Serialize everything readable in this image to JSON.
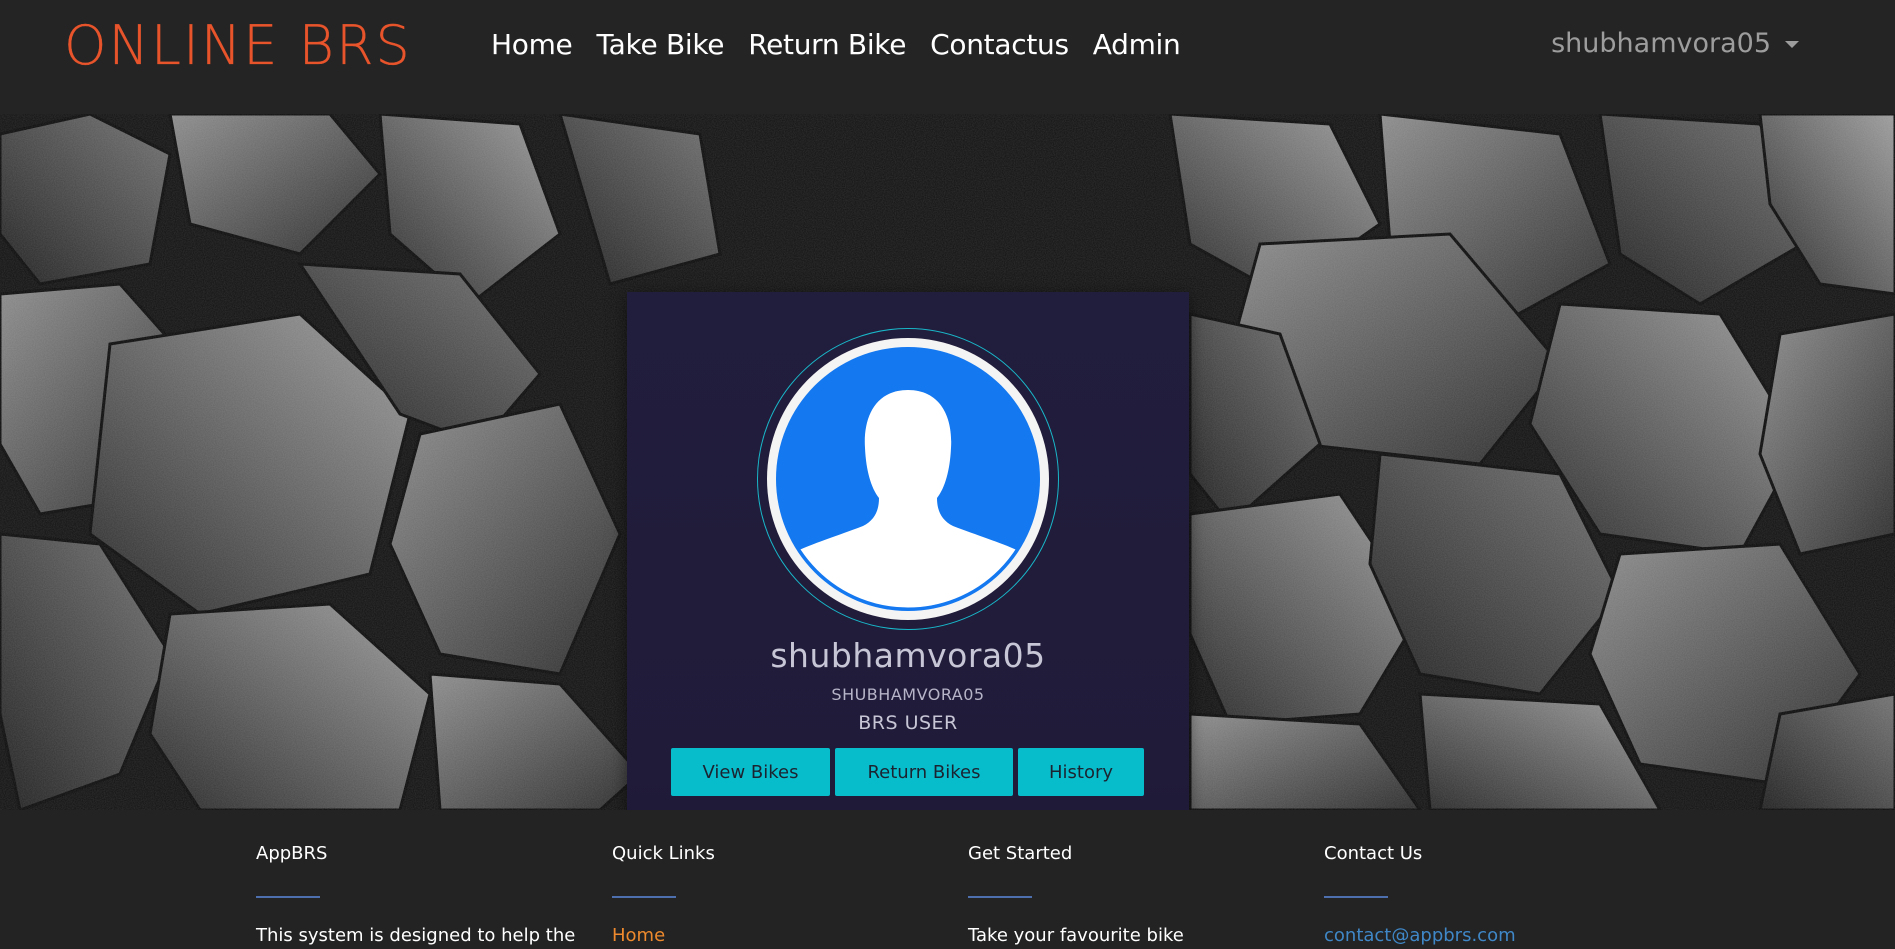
{
  "navbar": {
    "brand": "ONLINE BRS",
    "links": [
      "Home",
      "Take Bike",
      "Return Bike",
      "Contactus",
      "Admin"
    ],
    "user": "shubhamvora05"
  },
  "profile": {
    "username": "shubhamvora05",
    "user_id": "SHUBHAMVORA05",
    "role": "BRS USER",
    "buttons": [
      "View Bikes",
      "Return Bikes",
      "History"
    ]
  },
  "footer": {
    "columns": [
      {
        "heading": "AppBRS",
        "text": "This system is designed to help the"
      },
      {
        "heading": "Quick Links",
        "text": "Home"
      },
      {
        "heading": "Get Started",
        "text": "Take your favourite bike"
      },
      {
        "heading": "Contact Us",
        "text": "contact@appbrs.com"
      }
    ]
  },
  "colors": {
    "brand": "#e8542b",
    "accent_button": "#07bdcc",
    "card_bg": "#211d3c",
    "avatar_blue": "#1478f0",
    "footer_link": "#ee8a2d",
    "footer_email": "#3f87c7"
  },
  "icons": {
    "avatar": "user-silhouette-icon",
    "dropdown": "caret-down-icon"
  }
}
